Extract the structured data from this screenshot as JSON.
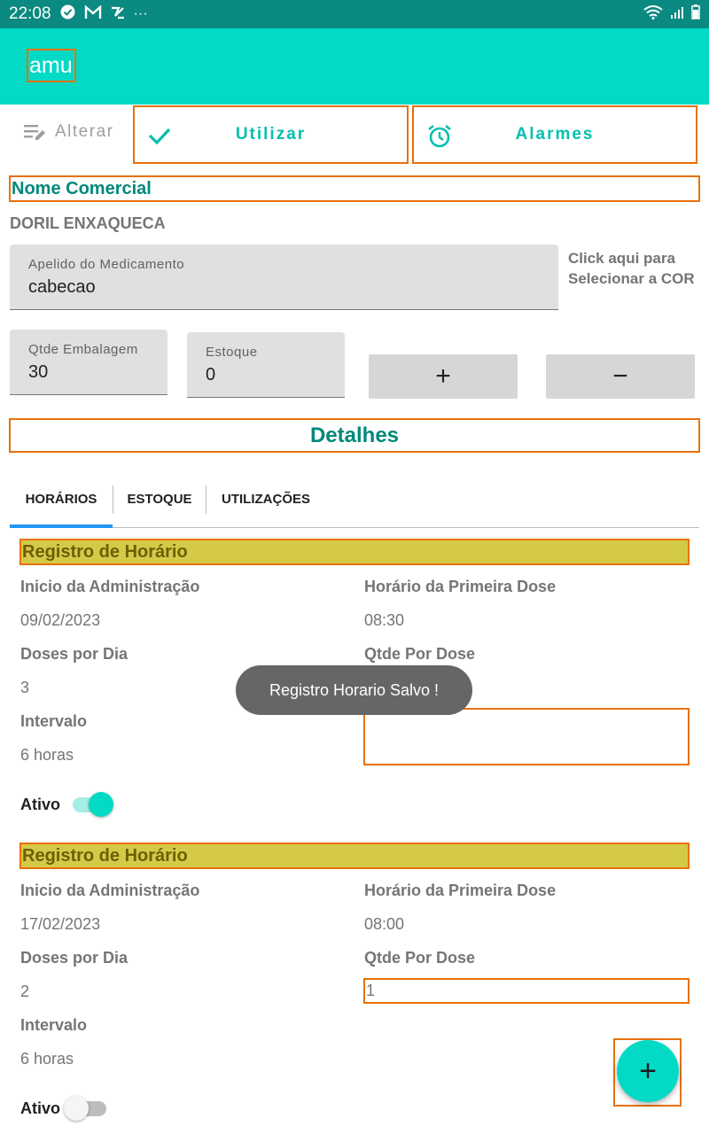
{
  "status_bar": {
    "time": "22:08",
    "icons": [
      "check-circle-icon",
      "gmail-icon",
      "pen-icon",
      "more-icon"
    ],
    "right_icons": [
      "wifi-icon",
      "signal-icon",
      "battery-icon"
    ],
    "more": "···"
  },
  "app_bar": {
    "title": "amu",
    "color": "#03dac5"
  },
  "actions": {
    "alterar": "Alterar",
    "utilizar": "Utilizar",
    "alarmes": "Alarmes"
  },
  "product": {
    "section_title": "Nome Comercial",
    "name": "DORIL ENXAQUECA",
    "apelido_label": "Apelido do Medicamento",
    "apelido_value": "cabecao",
    "cor_line1": "Click aqui para",
    "cor_line2": "Selecionar a COR",
    "qtde_label": "Qtde Embalagem",
    "qtde_value": "30",
    "estoque_label": "Estoque",
    "estoque_value": "0",
    "plus_label": "+",
    "minus_label": "−"
  },
  "detalhes": {
    "title": "Detalhes"
  },
  "tabs": [
    {
      "label": "HORÁRIOS",
      "active": true
    },
    {
      "label": "ESTOQUE",
      "active": false
    },
    {
      "label": "UTILIZAÇÕES",
      "active": false
    }
  ],
  "registros": [
    {
      "header": "Registro de Horário",
      "inicio_label": "Inicio da Administração",
      "inicio_value": "09/02/2023",
      "primeira_label": "Horário da Primeira Dose",
      "primeira_value": "08:30",
      "doses_label": "Doses por Dia",
      "doses_value": "3",
      "qtde_label": "Qtde Por Dose",
      "qtde_value": "",
      "intervalo_label": "Intervalo",
      "intervalo_value": "6 horas",
      "ativo_label": "Ativo",
      "ativo_on": true
    },
    {
      "header": "Registro de Horário",
      "inicio_label": "Inicio da Administração",
      "inicio_value": "17/02/2023",
      "primeira_label": "Horário da Primeira Dose",
      "primeira_value": "08:00",
      "doses_label": "Doses por Dia",
      "doses_value": "2",
      "qtde_label": "Qtde Por Dose",
      "qtde_value": "1",
      "intervalo_label": "Intervalo",
      "intervalo_value": "6 horas",
      "ativo_label": "Ativo",
      "ativo_on": false
    }
  ],
  "toast": {
    "message": "Registro Horario Salvo !"
  },
  "fab": {
    "label": "+"
  },
  "colors": {
    "accent": "#03dac5",
    "status_bar": "#0a8a80",
    "title_green": "#00897b",
    "highlight_border": "#e8710a",
    "header_yellow": "#d4ca48",
    "tab_indicator": "#2196f3"
  }
}
